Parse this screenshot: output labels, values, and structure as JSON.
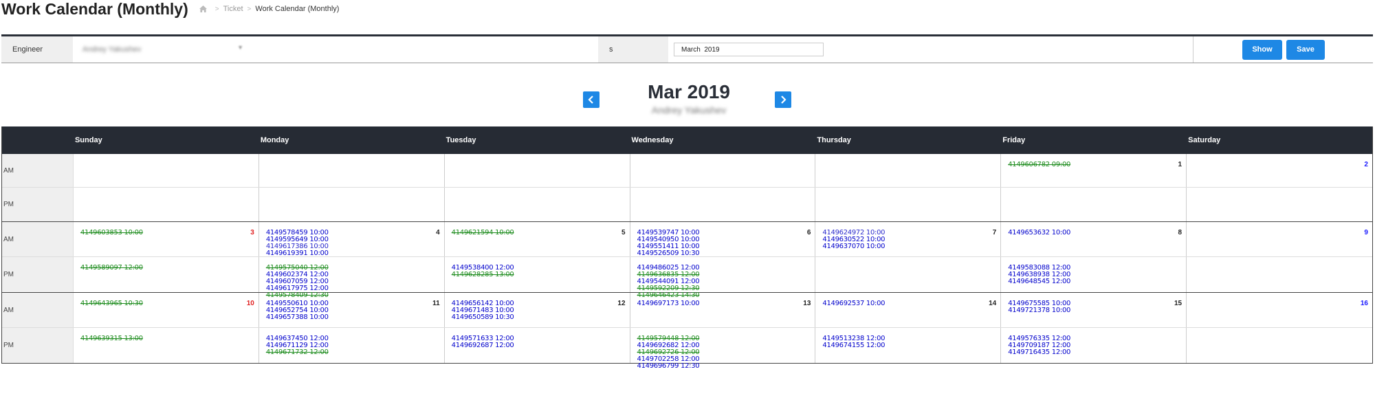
{
  "header": {
    "title": "Work Calendar (Monthly)",
    "breadcrumb": [
      "Ticket",
      "Work Calendar (Monthly)"
    ],
    "home_icon": "home-icon"
  },
  "filters": {
    "engineer_label": "Engineer",
    "engineer_value": "Andrey Yakushev",
    "s_label": "s",
    "month_value": "March  2019",
    "show_label": "Show",
    "save_label": "Save"
  },
  "month_nav": {
    "title": "Mar 2019",
    "subtitle": "Andrey Yakushev",
    "prev_icon": "chevron-left-icon",
    "next_icon": "chevron-right-icon"
  },
  "calendar": {
    "day_headers": [
      "Sunday",
      "Monday",
      "Tuesday",
      "Wednesday",
      "Thursday",
      "Friday",
      "Saturday"
    ],
    "am_label": "AM",
    "pm_label": "PM",
    "status_colors": {
      "open": "#0000cc",
      "done": "#1a8a1a"
    },
    "weeks": [
      {
        "days": [
          {
            "num": "",
            "am": [],
            "pm": []
          },
          {
            "num": "",
            "am": [],
            "pm": []
          },
          {
            "num": "",
            "am": [],
            "pm": []
          },
          {
            "num": "",
            "am": [],
            "pm": []
          },
          {
            "num": "",
            "am": [],
            "pm": []
          },
          {
            "num": "1",
            "am": [
              {
                "t": "4149606782 09:00",
                "s": "done"
              }
            ],
            "pm": []
          },
          {
            "num": "2",
            "am": [],
            "pm": []
          }
        ]
      },
      {
        "days": [
          {
            "num": "3",
            "am": [
              {
                "t": "4149603853 10:00",
                "s": "done"
              }
            ],
            "pm": [
              {
                "t": "4149589097 12:00",
                "s": "done"
              }
            ]
          },
          {
            "num": "4",
            "am": [
              {
                "t": "4149578459 10:00",
                "s": "open"
              },
              {
                "t": "4149595649 10:00",
                "s": "open"
              },
              {
                "t": "4149617386 10:00",
                "s": "new"
              },
              {
                "t": "4149619391 10:00",
                "s": "open"
              }
            ],
            "pm": [
              {
                "t": "4149575040 12:00",
                "s": "done"
              },
              {
                "t": "4149602374 12:00",
                "s": "open"
              },
              {
                "t": "4149607059 12:00",
                "s": "open"
              },
              {
                "t": "4149617975 12:00",
                "s": "open"
              },
              {
                "t": "4149578409 12:30",
                "s": "done"
              }
            ]
          },
          {
            "num": "5",
            "am": [
              {
                "t": "4149621594 10:00",
                "s": "done"
              }
            ],
            "pm": [
              {
                "t": "4149538400 12:00",
                "s": "open"
              },
              {
                "t": "4149628285 13:00",
                "s": "done"
              }
            ]
          },
          {
            "num": "6",
            "am": [
              {
                "t": "4149539747 10:00",
                "s": "open"
              },
              {
                "t": "4149540950 10:00",
                "s": "open"
              },
              {
                "t": "4149551411 10:00",
                "s": "open"
              },
              {
                "t": "4149526509 10:30",
                "s": "open"
              }
            ],
            "pm": [
              {
                "t": "4149486025 12:00",
                "s": "open"
              },
              {
                "t": "4149636835 12:00",
                "s": "done"
              },
              {
                "t": "4149544091 12:00",
                "s": "open"
              },
              {
                "t": "4149592209 12:30",
                "s": "done"
              },
              {
                "t": "4149646423 14:30",
                "s": "done"
              }
            ]
          },
          {
            "num": "7",
            "am": [
              {
                "t": "4149624972 10:00",
                "s": "new"
              },
              {
                "t": "4149630522 10:00",
                "s": "open"
              },
              {
                "t": "4149637070 10:00",
                "s": "open"
              }
            ],
            "pm": []
          },
          {
            "num": "8",
            "am": [
              {
                "t": "4149653632 10:00",
                "s": "open"
              }
            ],
            "pm": [
              {
                "t": "4149583088 12:00",
                "s": "open"
              },
              {
                "t": "4149638938 12:00",
                "s": "open"
              },
              {
                "t": "4149648545 12:00",
                "s": "open"
              }
            ]
          },
          {
            "num": "9",
            "am": [],
            "pm": []
          }
        ]
      },
      {
        "days": [
          {
            "num": "10",
            "am": [
              {
                "t": "4149643965 10:30",
                "s": "done"
              }
            ],
            "pm": [
              {
                "t": "4149639315 13:00",
                "s": "done"
              }
            ]
          },
          {
            "num": "11",
            "am": [
              {
                "t": "4149550610 10:00",
                "s": "open"
              },
              {
                "t": "4149652754 10:00",
                "s": "open"
              },
              {
                "t": "4149657388 10:00",
                "s": "open"
              }
            ],
            "pm": [
              {
                "t": "4149637450 12:00",
                "s": "open"
              },
              {
                "t": "4149671129 12:00",
                "s": "open"
              },
              {
                "t": "4149671732 12:00",
                "s": "done"
              }
            ]
          },
          {
            "num": "12",
            "am": [
              {
                "t": "4149656142 10:00",
                "s": "open"
              },
              {
                "t": "4149671483 10:00",
                "s": "open"
              },
              {
                "t": "4149650589 10:30",
                "s": "open"
              }
            ],
            "pm": [
              {
                "t": "4149571633 12:00",
                "s": "open"
              },
              {
                "t": "4149692687 12:00",
                "s": "open"
              }
            ]
          },
          {
            "num": "13",
            "am": [
              {
                "t": "4149697173 10:00",
                "s": "open"
              }
            ],
            "pm": [
              {
                "t": "4149579448 12:00",
                "s": "done"
              },
              {
                "t": "4149692682 12:00",
                "s": "open"
              },
              {
                "t": "4149692726 12:00",
                "s": "done"
              },
              {
                "t": "4149702258 12:00",
                "s": "open"
              },
              {
                "t": "4149696799 12:30",
                "s": "open"
              }
            ]
          },
          {
            "num": "14",
            "am": [
              {
                "t": "4149692537 10:00",
                "s": "open"
              }
            ],
            "pm": [
              {
                "t": "4149513238 12:00",
                "s": "open"
              },
              {
                "t": "4149674155 12:00",
                "s": "open"
              }
            ]
          },
          {
            "num": "15",
            "am": [
              {
                "t": "4149675585 10:00",
                "s": "open"
              },
              {
                "t": "4149721378 10:00",
                "s": "open"
              }
            ],
            "pm": [
              {
                "t": "4149576335 12:00",
                "s": "open"
              },
              {
                "t": "4149709187 12:00",
                "s": "open"
              },
              {
                "t": "4149716435 12:00",
                "s": "open"
              }
            ]
          },
          {
            "num": "16",
            "am": [],
            "pm": []
          }
        ]
      }
    ]
  }
}
